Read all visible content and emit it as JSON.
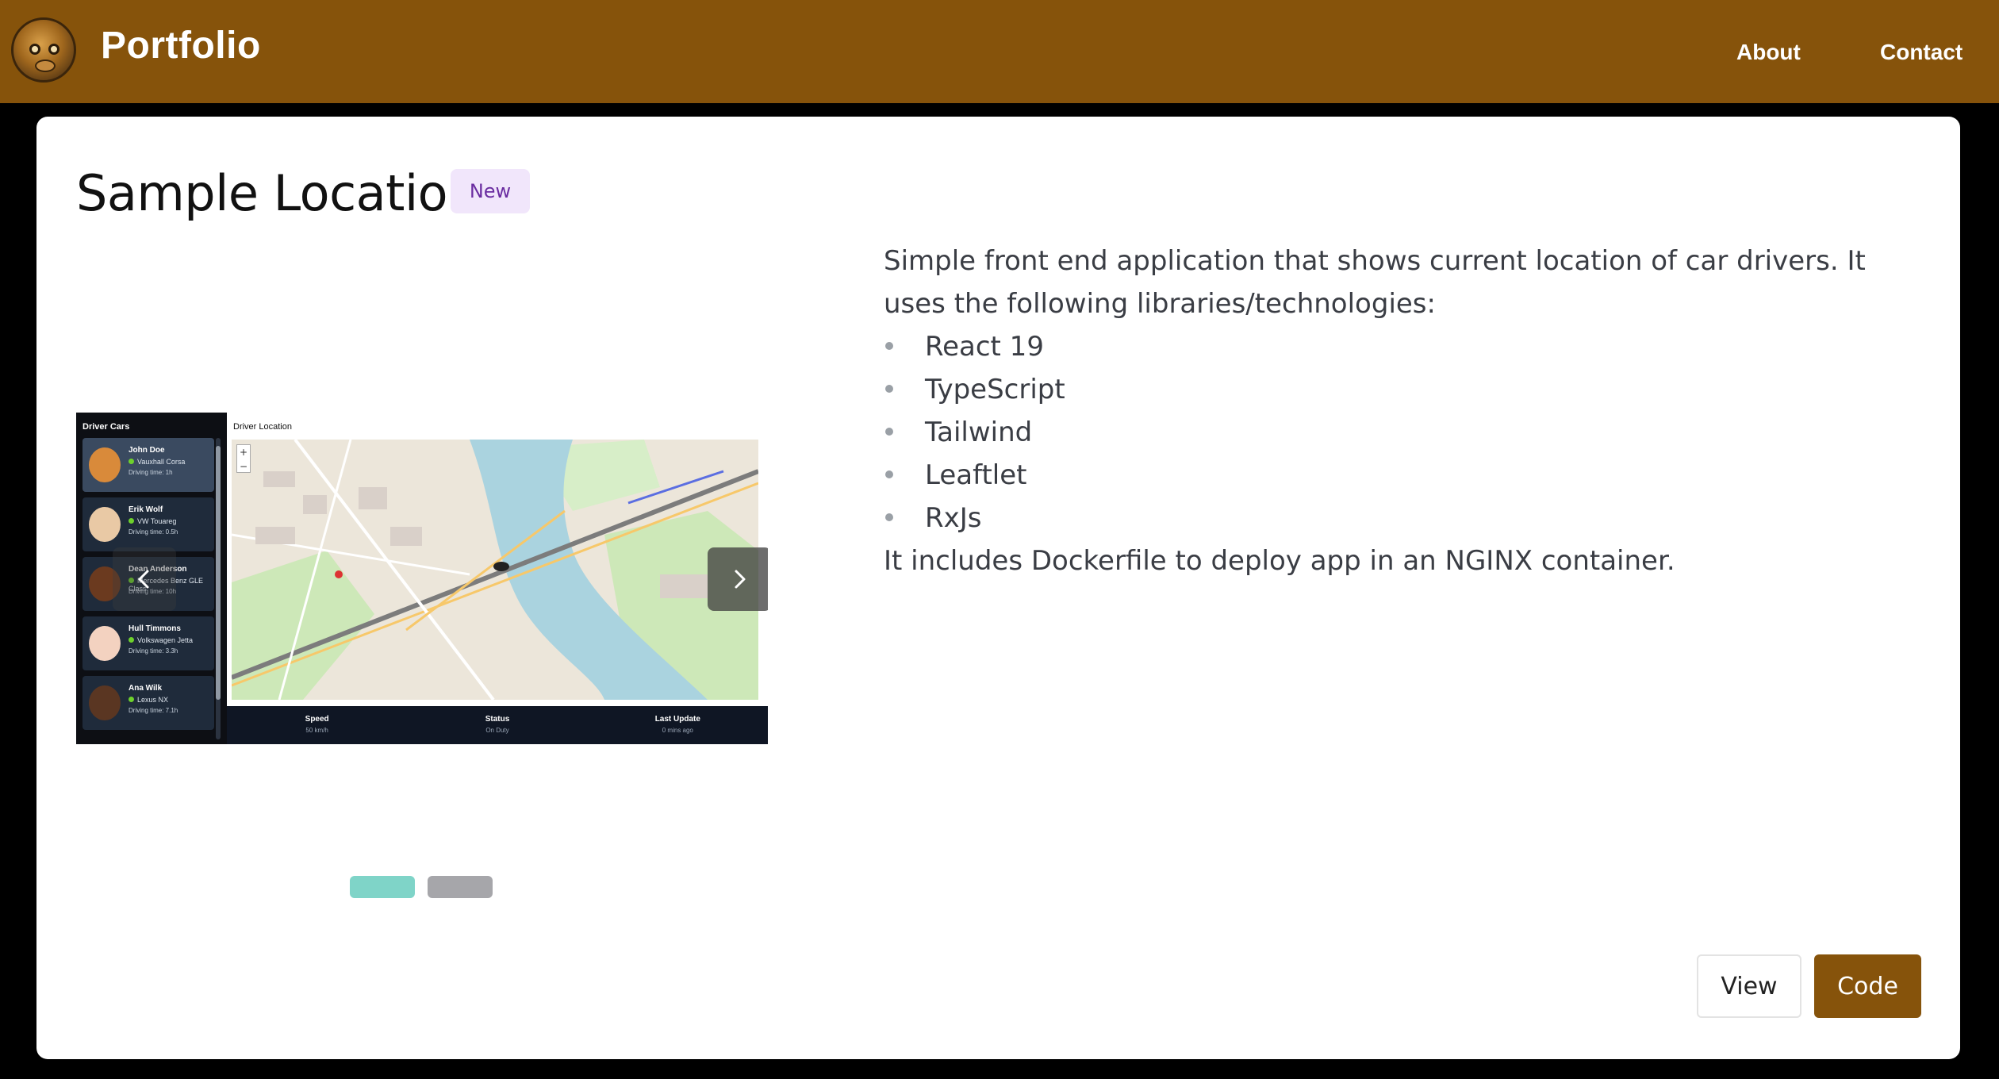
{
  "header": {
    "brand": "Portfolio",
    "nav": [
      {
        "label": "About"
      },
      {
        "label": "Contact"
      }
    ],
    "colors": {
      "header_bg": "#86530b",
      "page_bg": "#000000"
    }
  },
  "project": {
    "title": "Sample Location",
    "badge": "New",
    "description": "Simple front end application that shows current location of car drivers. It uses the following libraries/technologies:",
    "technologies": [
      "React 19",
      "TypeScript",
      "Tailwind",
      "Leaftlet",
      "RxJs"
    ],
    "footer_note": "It includes Dockerfile to deploy app in an NGINX container.",
    "buttons": {
      "view": "View",
      "code": "Code"
    }
  },
  "carousel": {
    "slide_count": 2,
    "active_index": 0,
    "indicator_colors": {
      "active": "#7fd4c8",
      "inactive": "#a6a6aa"
    },
    "screenshot": {
      "sidebar_title": "Driver Cars",
      "main_title": "Driver Location",
      "drivers": [
        {
          "name": "John Doe",
          "car": "Vauxhall Corsa",
          "time": "Driving time: 1h",
          "avatar_color": "#d98a3a"
        },
        {
          "name": "Erik Wolf",
          "car": "VW Touareg",
          "time": "Driving time: 0.5h",
          "avatar_color": "#e9c9a5"
        },
        {
          "name": "Dean Anderson",
          "car": "Mercedes Benz GLE Class",
          "time": "Driving time: 10h",
          "avatar_color": "#6b3a1f"
        },
        {
          "name": "Hull Timmons",
          "car": "Volkswagen Jetta",
          "time": "Driving time: 3.3h",
          "avatar_color": "#f3d2c0"
        },
        {
          "name": "Ana Wilk",
          "car": "Lexus NX",
          "time": "Driving time: 7.1h",
          "avatar_color": "#5a3622"
        }
      ],
      "stats": [
        {
          "label": "Speed",
          "value": "50 km/h"
        },
        {
          "label": "Status",
          "value": "On Duty"
        },
        {
          "label": "Last Update",
          "value": "0 mins ago"
        }
      ]
    }
  }
}
